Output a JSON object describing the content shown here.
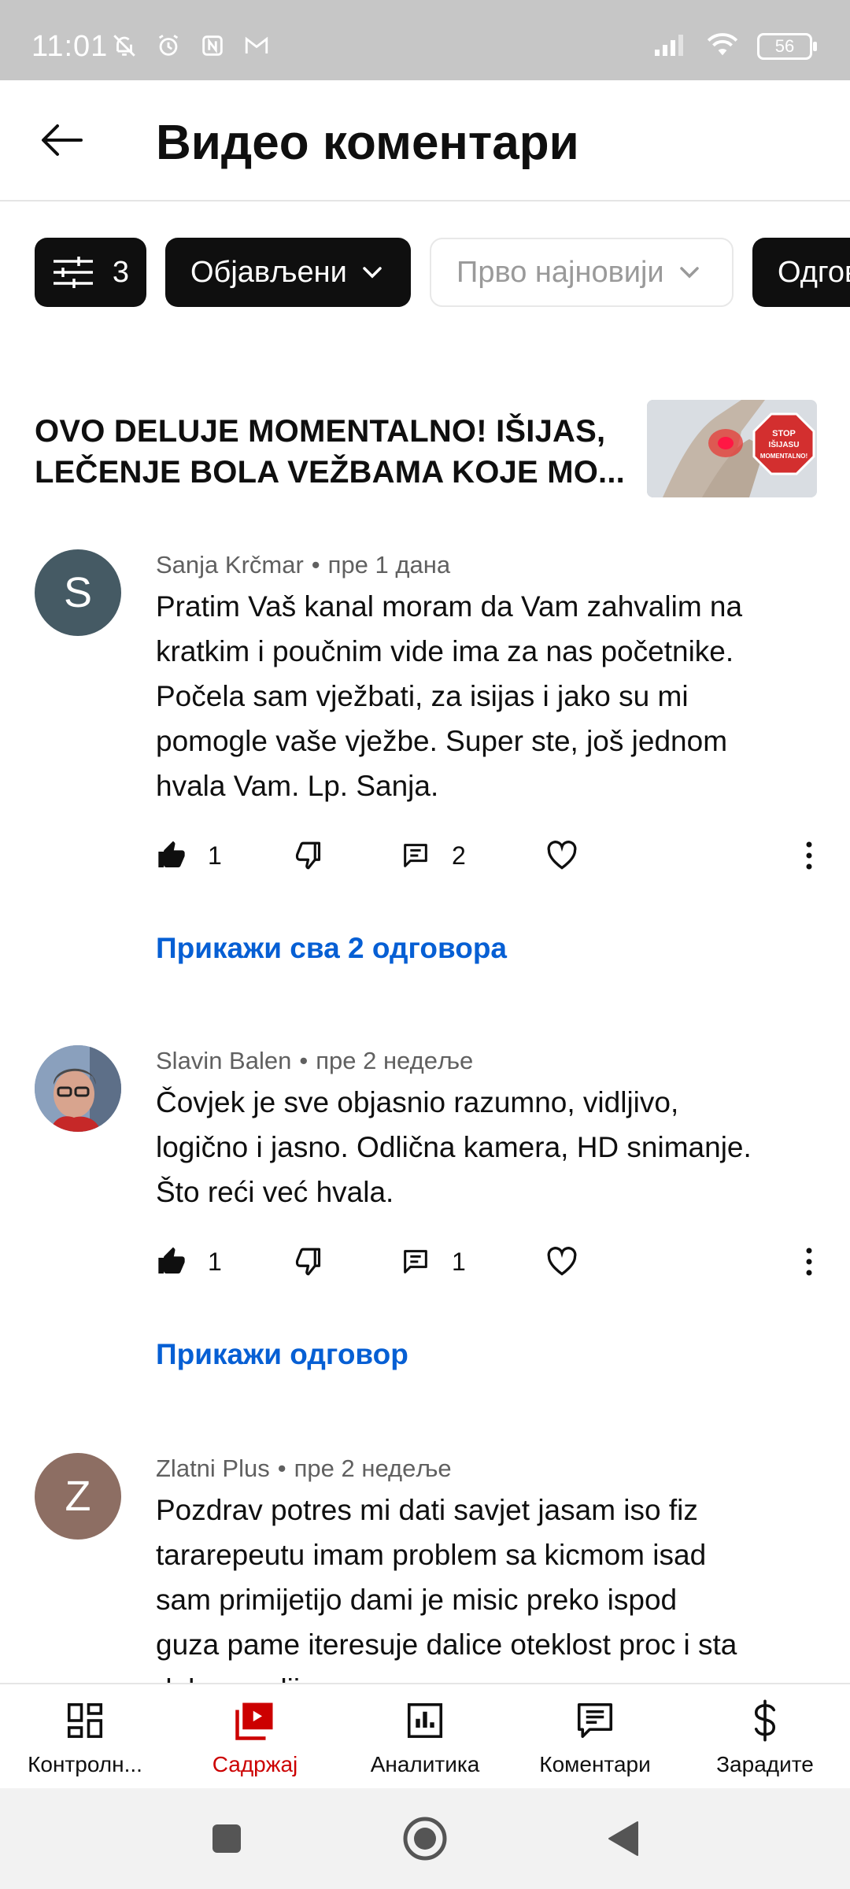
{
  "status_bar": {
    "time": "11:01",
    "battery": "56"
  },
  "header": {
    "title": "Видео коментари"
  },
  "filters": {
    "filter_count": "3",
    "published": "Објављени",
    "sort": "Прво најновији",
    "partial": "Одгово"
  },
  "video": {
    "title_line1": "OVO DELUJE MOMENTALNO! IŠIJAS,",
    "title_line2": "LEČENJE BOLA VEŽBAMA KOJE MO...",
    "thumbnail_sign": [
      "STOP",
      "IŠIJASU",
      "MOMENTALNO!"
    ]
  },
  "comments": [
    {
      "author": "Sanja Krčmar",
      "time": "пре 1 дана",
      "avatar_letter": "S",
      "avatar_color": "#455a64",
      "lines": [
        "Pratim Vaš kanal moram da Vam zahvalim na",
        "kratkim i poučnim vide ima za nas početnike.",
        "Počela sam vježbati, za isijas i jako su mi",
        "pomogle vaše vježbe. Super ste, još jednom",
        "hvala Vam. Lp. Sanja."
      ],
      "likes": "1",
      "replies": "2",
      "replies_link": "Прикажи сва 2 одговора"
    },
    {
      "author": "Slavin Balen",
      "time": "пре 2 недеље",
      "avatar_letter": "",
      "avatar_color": "#7b8da6",
      "lines": [
        "Čovjek je sve objasnio razumno, vidljivo,",
        "logično i jasno. Odlična kamera, HD snimanje.",
        "Što reći već hvala."
      ],
      "likes": "1",
      "replies": "1",
      "replies_link": "Прикажи одговор"
    },
    {
      "author": "Zlatni Plus",
      "time": "пре 2 недеље",
      "avatar_letter": "Z",
      "avatar_color": "#8d6e63",
      "lines": [
        "Pozdrav potres mi dati savjet jasam iso fiz",
        "tararepeutu imam problem sa kicmom isad",
        "sam primijetijo dami je misic preko ispod",
        "guza pame iteresuje dalice oteklost proc i sta",
        "dabu uradijo"
      ]
    }
  ],
  "bottom_nav": {
    "items": [
      {
        "label": "Контролн...",
        "icon": "dashboard-icon"
      },
      {
        "label": "Садржај",
        "icon": "content-icon"
      },
      {
        "label": "Аналитика",
        "icon": "analytics-icon"
      },
      {
        "label": "Коментари",
        "icon": "comments-icon"
      },
      {
        "label": "Зарадите",
        "icon": "earn-icon"
      }
    ],
    "active_index": 1
  },
  "colors": {
    "accent_red": "#cc0000",
    "link_blue": "#065fd4",
    "chip_dark": "#0f0f0f"
  }
}
